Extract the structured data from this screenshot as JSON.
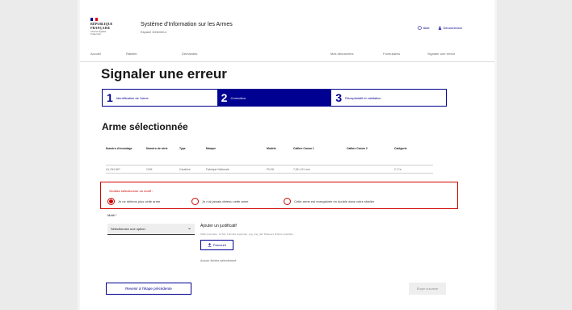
{
  "header": {
    "logo_line1": "RÉPUBLIQUE",
    "logo_line2": "FRANÇAISE",
    "logo_motto": "Liberté Égalité Fraternité",
    "site_title": "Système d'Information sur les Armes",
    "site_subtitle": "Espace Détenteur",
    "aide_label": "Aide",
    "account_label": "Déconnexion"
  },
  "nav": {
    "items": [
      "Accueil",
      "Râtelier",
      "Demandes",
      "Mes démarches",
      "Formulaires",
      "Signaler une erreur"
    ]
  },
  "page_title": "Signaler une erreur",
  "stepper": {
    "steps": [
      {
        "num": "1",
        "label": "Identification de l'arme"
      },
      {
        "num": "2",
        "label": "Correction"
      },
      {
        "num": "3",
        "label": "Récapitulatif et validation"
      }
    ]
  },
  "section_title": "Arme sélectionnée",
  "table": {
    "headers": [
      "Numéro d'encodage",
      "Numéro de série",
      "Type",
      "Marque",
      "Modèle",
      "Calibre Canon 1",
      "Calibre Canon 2",
      "Catégorie"
    ],
    "row": [
      "A1-234-567",
      "1234",
      "Carabine",
      "Fabrique Nationale",
      "FN 30",
      "7,62 x 51 mm",
      "",
      "C 1°a"
    ]
  },
  "error": {
    "legend": "Veuillez sélectionner un motif :",
    "options": [
      "Je ne détiens plus cette arme",
      "Je n'ai jamais détenu cette arme",
      "Cette arme est enregistrée en double dans votre râtelier"
    ]
  },
  "motif": {
    "label": "Motif *",
    "select_value": "Sélectionnez une option"
  },
  "upload": {
    "label": "Ajouter un justificatif",
    "hint": "Taille maximale : 10 Mo. Formats supportés : jpg, png, pdf. Plusieurs fichiers possibles.",
    "button": "Parcourir",
    "status": "Aucun fichier sélectionné"
  },
  "buttons": {
    "back": "Revenir à l'étape précédente",
    "next": "Étape suivante"
  },
  "colors": {
    "primary": "#000091",
    "error": "#ce0500"
  }
}
